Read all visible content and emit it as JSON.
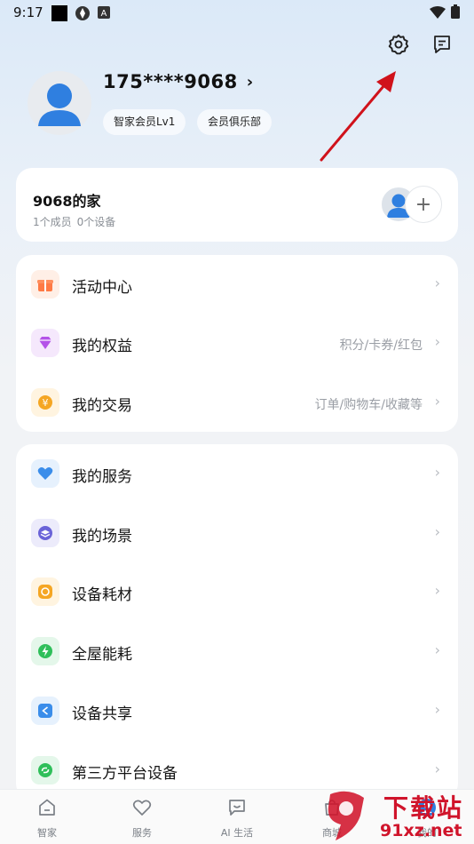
{
  "status_bar": {
    "time": "9:17",
    "icons": [
      "notification-square-icon",
      "sync-icon",
      "app-a-icon"
    ],
    "right_icons": [
      "wifi-icon",
      "battery-icon"
    ]
  },
  "header": {
    "settings_icon": "gear-icon",
    "message_icon": "message-icon"
  },
  "profile": {
    "username": "175****9068",
    "badges": [
      "智家会员Lv1",
      "会员俱乐部"
    ]
  },
  "home": {
    "title": "9068的家",
    "members": "1个成员",
    "devices": "0个设备"
  },
  "menu_group_1": [
    {
      "label": "活动中心",
      "right": "",
      "icon": "gift-icon",
      "color": "#ff7a45"
    },
    {
      "label": "我的权益",
      "right": "积分/卡券/红包",
      "icon": "diamond-icon",
      "color": "#b452e8"
    },
    {
      "label": "我的交易",
      "right": "订单/购物车/收藏等",
      "icon": "coin-icon",
      "color": "#f5a623"
    }
  ],
  "menu_group_2": [
    {
      "label": "我的服务",
      "right": "",
      "icon": "heart-icon",
      "color": "#3a8dea"
    },
    {
      "label": "我的场景",
      "right": "",
      "icon": "layers-icon",
      "color": "#6a63d8"
    },
    {
      "label": "设备耗材",
      "right": "",
      "icon": "refresh-icon",
      "color": "#f5a623"
    },
    {
      "label": "全屋能耗",
      "right": "",
      "icon": "bolt-icon",
      "color": "#2fbf5a"
    },
    {
      "label": "设备共享",
      "right": "",
      "icon": "share-icon",
      "color": "#3a8dea"
    },
    {
      "label": "第三方平台设备",
      "right": "",
      "icon": "link-icon",
      "color": "#2fbf5a"
    }
  ],
  "bottom_nav": [
    {
      "label": "智家",
      "icon": "home-icon"
    },
    {
      "label": "服务",
      "icon": "heart-icon"
    },
    {
      "label": "AI 生活",
      "icon": "chat-icon"
    },
    {
      "label": "商城",
      "icon": "bag-icon"
    },
    {
      "label": "我的",
      "icon": "user-icon"
    }
  ],
  "watermark": {
    "line1": "下载站",
    "line2": "91xz.net"
  }
}
